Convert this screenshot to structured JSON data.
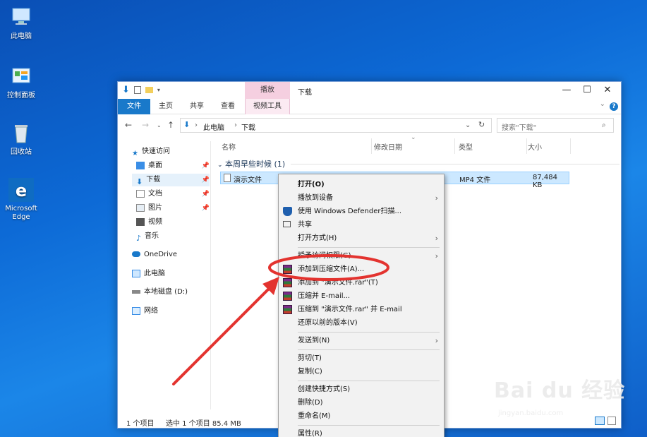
{
  "desktop": {
    "icons": [
      {
        "label": "此电脑"
      },
      {
        "label": "控制面板"
      },
      {
        "label": "回收站"
      },
      {
        "label": "Microsoft Edge"
      }
    ]
  },
  "window": {
    "tool_tab": "播放",
    "title": "下载",
    "menus": [
      "文件",
      "主页",
      "共享",
      "查看",
      "视频工具"
    ],
    "controls": {
      "minimize": "—",
      "maximize": "☐",
      "close": "✕"
    },
    "help": "?"
  },
  "address": {
    "breadcrumb": [
      "此电脑",
      "下载"
    ],
    "search_placeholder": "搜索\"下载\""
  },
  "nav": {
    "quick_access": "快速访问",
    "items": [
      {
        "label": "桌面",
        "pinned": true
      },
      {
        "label": "下载",
        "pinned": true,
        "selected": true
      },
      {
        "label": "文档",
        "pinned": true
      },
      {
        "label": "图片",
        "pinned": true
      },
      {
        "label": "视频",
        "pinned": false
      },
      {
        "label": "音乐",
        "pinned": false
      }
    ],
    "onedrive": "OneDrive",
    "thispc": "此电脑",
    "localdisk": "本地磁盘 (D:)",
    "network": "网络"
  },
  "list": {
    "columns": [
      "名称",
      "修改日期",
      "类型",
      "大小"
    ],
    "group": "本周早些时候 (1)",
    "file": {
      "name": "演示文件",
      "type": "MP4 文件",
      "size": "87,484 KB"
    }
  },
  "status": {
    "count": "1 个项目",
    "selected": "选中 1 个项目  85.4 MB"
  },
  "context_menu": {
    "items": [
      {
        "label": "打开(O)"
      },
      {
        "label": "播放到设备"
      },
      {
        "label": "使用 Windows Defender扫描..."
      },
      {
        "label": "共享"
      },
      {
        "label": "打开方式(H)"
      },
      {
        "label": "授予访问权限(G)"
      },
      {
        "label": "添加到压缩文件(A)..."
      },
      {
        "label": "添加到 \"演示文件.rar\"(T)"
      },
      {
        "label": "压缩并 E-mail..."
      },
      {
        "label": "压缩到 \"演示文件.rar\" 并 E-mail"
      },
      {
        "label": "还原以前的版本(V)"
      },
      {
        "label": "发送到(N)"
      },
      {
        "label": "剪切(T)"
      },
      {
        "label": "复制(C)"
      },
      {
        "label": "创建快捷方式(S)"
      },
      {
        "label": "删除(D)"
      },
      {
        "label": "重命名(M)"
      },
      {
        "label": "属性(R)"
      }
    ]
  },
  "watermark": {
    "brand": "Bai du 经验",
    "url": "jingyan.baidu.com"
  },
  "colors": {
    "desktop": "#0d6ad6",
    "file_tab": "#1979ca",
    "tool_tab": "#f5cfe0",
    "selection": "#cce8ff",
    "annotation_red": "#e3332f"
  }
}
